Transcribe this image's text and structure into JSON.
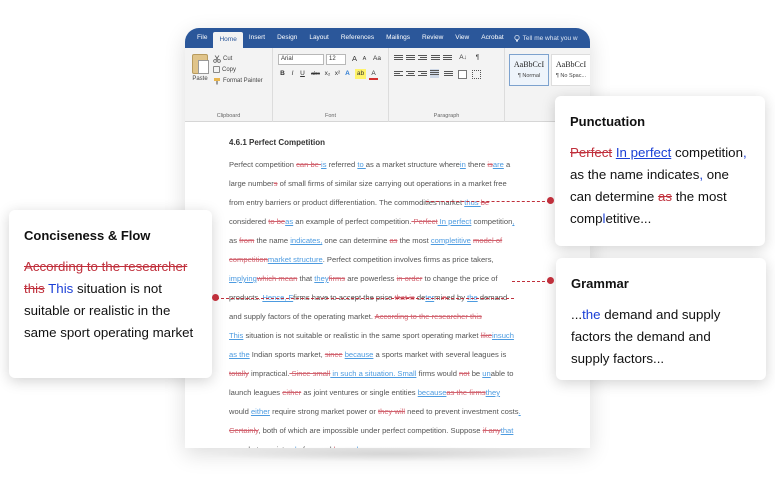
{
  "ribbon": {
    "tabs": [
      "File",
      "Home",
      "Insert",
      "Design",
      "Layout",
      "References",
      "Mailings",
      "Review",
      "View",
      "Acrobat"
    ],
    "tell_me": "Tell me what you w",
    "clipboard": {
      "paste": "Paste",
      "cut": "Cut",
      "copy": "Copy",
      "format_painter": "Format Painter",
      "label": "Clipboard"
    },
    "font": {
      "name": "Arial",
      "size": "12",
      "label": "Font",
      "bold": "B",
      "italic": "I",
      "underline": "U",
      "strike": "abc",
      "sub": "x₂",
      "sup": "x²",
      "effects": "A",
      "highlight": "ab",
      "color": "A",
      "grow": "A",
      "shrink": "A",
      "case": "Aa"
    },
    "paragraph": {
      "label": "Paragraph",
      "sort": "A↓",
      "marks": "¶"
    },
    "styles": [
      {
        "sample": "AaBbCcI",
        "name": "¶ Normal"
      },
      {
        "sample": "AaBbCcI",
        "name": "¶ No Spac..."
      }
    ]
  },
  "document": {
    "heading": "4.6.1 Perfect Competition",
    "lines": [
      [
        [
          "t",
          "Perfect competition "
        ],
        [
          "d",
          "can be "
        ],
        [
          "i",
          "is"
        ],
        [
          "t",
          " referred "
        ],
        [
          "i",
          "to "
        ],
        [
          "t",
          "as a market structure where"
        ],
        [
          "i",
          "in"
        ],
        [
          "t",
          " there "
        ],
        [
          "d",
          "is"
        ],
        [
          "i",
          "are"
        ],
        [
          "t",
          " a"
        ]
      ],
      [
        [
          "t",
          "large number"
        ],
        [
          "d",
          "s"
        ],
        [
          "t",
          " of small firms of similar size carrying out operations in a market free"
        ]
      ],
      [
        [
          "t",
          "from entry barriers or product differentiation. The commodities market "
        ],
        [
          "i",
          "thus "
        ],
        [
          "d",
          "be"
        ]
      ],
      [
        [
          "t",
          "considered "
        ],
        [
          "d",
          "to be"
        ],
        [
          "i",
          "as"
        ],
        [
          "t",
          " an example of perfect competition."
        ],
        [
          "d",
          " Perfect"
        ],
        [
          "i",
          " In perfect"
        ],
        [
          "t",
          " competition"
        ],
        [
          "i",
          ","
        ]
      ],
      [
        [
          "t",
          "as "
        ],
        [
          "d",
          "from"
        ],
        [
          "t",
          " the name "
        ],
        [
          "i",
          "indicates,"
        ],
        [
          "t",
          " one can determine "
        ],
        [
          "d",
          "as"
        ],
        [
          "t",
          " the most "
        ],
        [
          "i",
          "completitive"
        ],
        [
          "t",
          " "
        ],
        [
          "d",
          "model of"
        ]
      ],
      [
        [
          "d",
          "competition"
        ],
        [
          "i",
          "market structure"
        ],
        [
          "t",
          ". Perfect competition involves firms as price takers,"
        ]
      ],
      [
        [
          "i",
          "implying"
        ],
        [
          "d",
          "which mean"
        ],
        [
          "t",
          " that "
        ],
        [
          "i",
          "they"
        ],
        [
          "d",
          "firms"
        ],
        [
          "t",
          " are powerless "
        ],
        [
          "d",
          "in order"
        ],
        [
          "t",
          " to change the price of"
        ]
      ],
      [
        [
          "t",
          "products. "
        ],
        [
          "i",
          "Hence, F"
        ],
        [
          "t",
          "firms have to accept the price "
        ],
        [
          "d",
          "that is"
        ],
        [
          "t",
          " de"
        ],
        [
          "i",
          "ter"
        ],
        [
          "t",
          "mi"
        ],
        [
          "d",
          "n"
        ],
        [
          "t",
          "ed by "
        ],
        [
          "i",
          "the"
        ],
        [
          "t",
          " demand"
        ]
      ],
      [
        [
          "t",
          "and supply factors of the operating market. "
        ],
        [
          "d",
          "According to the researcher this"
        ]
      ],
      [
        [
          "i",
          "This"
        ],
        [
          "t",
          " situation is not suitable or realistic in the same sport operating market "
        ],
        [
          "d",
          "like"
        ],
        [
          "i",
          "in"
        ],
        [
          "i",
          "such"
        ]
      ],
      [
        [
          "i",
          "as the"
        ],
        [
          "t",
          " Indian sports market, "
        ],
        [
          "d",
          "since"
        ],
        [
          "t",
          " "
        ],
        [
          "i",
          "because"
        ],
        [
          "t",
          " a sports market with several leagues is"
        ]
      ],
      [
        [
          "d",
          "totally"
        ],
        [
          "t",
          " impractical."
        ],
        [
          "d",
          " Since small"
        ],
        [
          "i",
          " in such a situation. Small"
        ],
        [
          "t",
          " firms would "
        ],
        [
          "d",
          "not"
        ],
        [
          "t",
          " be "
        ],
        [
          "i",
          "un"
        ],
        [
          "t",
          "able to"
        ]
      ],
      [
        [
          "t",
          "launch leagues "
        ],
        [
          "d",
          "either"
        ],
        [
          "t",
          " as joint ventures or single entities "
        ],
        [
          "i",
          "because"
        ],
        [
          "d",
          "as the firms"
        ],
        [
          "i",
          "they"
        ]
      ],
      [
        [
          "t",
          "would "
        ],
        [
          "i",
          "either"
        ],
        [
          "t",
          " require strong market power or "
        ],
        [
          "d",
          "they will"
        ],
        [
          "t",
          " need to prevent investment costs"
        ],
        [
          "i",
          "."
        ]
      ],
      [
        [
          "d",
          "Certainly"
        ],
        [
          "t",
          ", both of which are impossible under perfect competition. Suppose "
        ],
        [
          "d",
          "if any"
        ],
        [
          "i",
          "that"
        ]
      ],
      [
        [
          "i",
          "a"
        ],
        [
          "t",
          " market consist"
        ],
        [
          "d",
          "s"
        ],
        [
          "i",
          "ed"
        ],
        [
          "t",
          " of several "
        ],
        [
          "d",
          "league"
        ],
        [
          "i",
          "leagues."
        ]
      ]
    ]
  },
  "cards": {
    "punctuation": {
      "title": "Punctuation",
      "del1": "Perfect",
      "ins1": "In perfect",
      "text1": "competition",
      "comma": ",",
      "text2": " as the name indicates",
      "text3": " one can determine",
      "del2": "as",
      "text4": " the most comp",
      "caret": "l",
      "text5": "etitive..."
    },
    "conciseness": {
      "title": "Conciseness & Flow",
      "del": "According to the researcher this",
      "ins": "This",
      "text": " situation is not suitable or realistic in the same sport operating market"
    },
    "grammar": {
      "title": "Grammar",
      "prefix": "...",
      "ins": "the",
      "text": " demand and supply factors the demand and supply factors..."
    }
  },
  "colors": {
    "ribbon_blue": "#2b579a",
    "deletion": "#c0303c",
    "insertion": "#1a3fd6",
    "doc_deletion": "#d26470",
    "doc_insertion": "#4d9be0"
  }
}
